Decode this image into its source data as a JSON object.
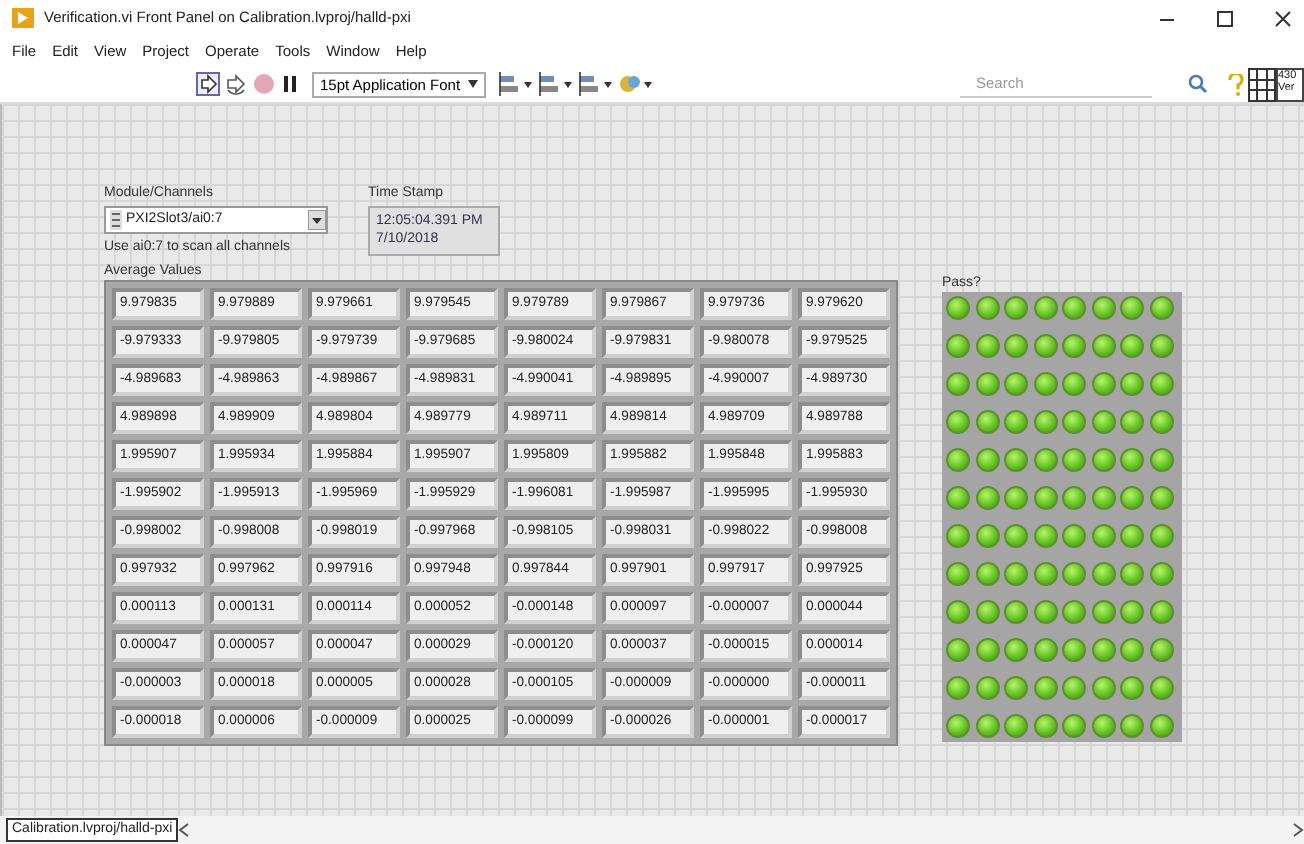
{
  "window": {
    "title": "Verification.vi Front Panel on Calibration.lvproj/halld-pxi"
  },
  "menu": [
    "File",
    "Edit",
    "View",
    "Project",
    "Operate",
    "Tools",
    "Window",
    "Help"
  ],
  "toolbar": {
    "font": "15pt Application Font"
  },
  "search": {
    "placeholder": "Search"
  },
  "connector_pane": {
    "lines": [
      "430",
      "Ver"
    ]
  },
  "module_channels": {
    "label": "Module/Channels",
    "value": "PXI2Slot3/ai0:7",
    "hint": "Use ai0:7 to scan all channels"
  },
  "time_stamp": {
    "label": "Time Stamp",
    "lines": [
      "12:05:04.391 PM",
      "7/10/2018"
    ]
  },
  "average_values": {
    "label": "Average Values",
    "rows": [
      [
        "9.979835",
        "9.979889",
        "9.979661",
        "9.979545",
        "9.979789",
        "9.979867",
        "9.979736",
        "9.979620"
      ],
      [
        "-9.979333",
        "-9.979805",
        "-9.979739",
        "-9.979685",
        "-9.980024",
        "-9.979831",
        "-9.980078",
        "-9.979525"
      ],
      [
        "-4.989683",
        "-4.989863",
        "-4.989867",
        "-4.989831",
        "-4.990041",
        "-4.989895",
        "-4.990007",
        "-4.989730"
      ],
      [
        "4.989898",
        "4.989909",
        "4.989804",
        "4.989779",
        "4.989711",
        "4.989814",
        "4.989709",
        "4.989788"
      ],
      [
        "1.995907",
        "1.995934",
        "1.995884",
        "1.995907",
        "1.995809",
        "1.995882",
        "1.995848",
        "1.995883"
      ],
      [
        "-1.995902",
        "-1.995913",
        "-1.995969",
        "-1.995929",
        "-1.996081",
        "-1.995987",
        "-1.995995",
        "-1.995930"
      ],
      [
        "-0.998002",
        "-0.998008",
        "-0.998019",
        "-0.997968",
        "-0.998105",
        "-0.998031",
        "-0.998022",
        "-0.998008"
      ],
      [
        "0.997932",
        "0.997962",
        "0.997916",
        "0.997948",
        "0.997844",
        "0.997901",
        "0.997917",
        "0.997925"
      ],
      [
        "0.000113",
        "0.000131",
        "0.000114",
        "0.000052",
        "-0.000148",
        "0.000097",
        "-0.000007",
        "0.000044"
      ],
      [
        "0.000047",
        "0.000057",
        "0.000047",
        "0.000029",
        "-0.000120",
        "0.000037",
        "-0.000015",
        "0.000014"
      ],
      [
        "-0.000003",
        "0.000018",
        "0.000005",
        "0.000028",
        "-0.000105",
        "-0.000009",
        "-0.000000",
        "-0.000011"
      ],
      [
        "-0.000018",
        "0.000006",
        "-0.000009",
        "0.000025",
        "-0.000099",
        "-0.000026",
        "-0.000001",
        "-0.000017"
      ]
    ]
  },
  "pass": {
    "label": "Pass?",
    "leds": [
      [
        true,
        true,
        true,
        true,
        true,
        true,
        true,
        true
      ],
      [
        true,
        true,
        true,
        true,
        true,
        true,
        true,
        true
      ],
      [
        true,
        true,
        true,
        true,
        true,
        true,
        true,
        true
      ],
      [
        true,
        true,
        true,
        true,
        true,
        true,
        true,
        true
      ],
      [
        true,
        true,
        true,
        true,
        true,
        true,
        true,
        true
      ],
      [
        true,
        true,
        true,
        true,
        true,
        true,
        true,
        true
      ],
      [
        true,
        true,
        true,
        true,
        true,
        true,
        true,
        true
      ],
      [
        true,
        true,
        true,
        true,
        true,
        true,
        true,
        true
      ],
      [
        true,
        true,
        true,
        true,
        true,
        true,
        true,
        true
      ],
      [
        true,
        true,
        true,
        true,
        true,
        true,
        true,
        true
      ],
      [
        true,
        true,
        true,
        true,
        true,
        true,
        true,
        true
      ],
      [
        true,
        true,
        true,
        true,
        true,
        true,
        true,
        true
      ]
    ]
  },
  "status_bar": {
    "path": "Calibration.lvproj/halld-pxi"
  }
}
